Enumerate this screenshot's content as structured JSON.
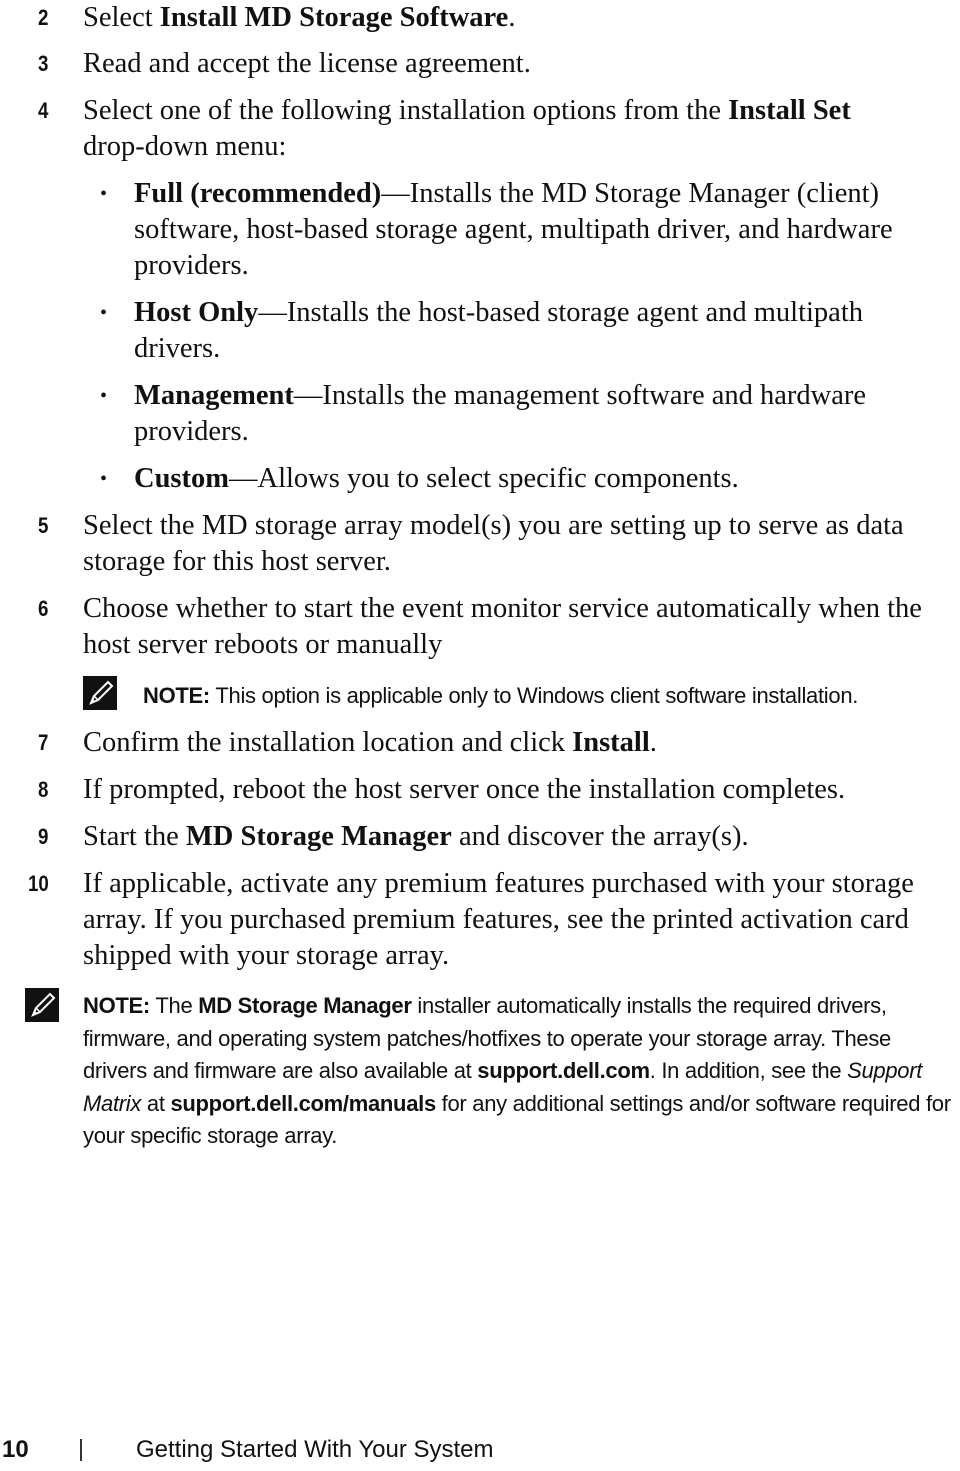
{
  "steps": [
    {
      "num": "2",
      "pre": "Select ",
      "bold": "Install MD Storage Software",
      "post": "."
    },
    {
      "num": "3",
      "text": "Read and accept the license agreement."
    },
    {
      "num": "4",
      "pre": "Select one of the following installation options from the ",
      "bold": "Install Set",
      "post": " drop-down menu:"
    },
    {
      "num": "5",
      "text": "Select the MD storage array model(s) you are setting up to serve as data storage for this host server."
    },
    {
      "num": "6",
      "text": "Choose whether to start the event monitor service automatically when the host server reboots or manually"
    },
    {
      "num": "7",
      "pre": "Confirm the installation location and click ",
      "bold": "Install",
      "post": "."
    },
    {
      "num": "8",
      "text": "If prompted, reboot the host server once the installation completes."
    },
    {
      "num": "9",
      "pre": "Start the ",
      "bold": "MD Storage Manager",
      "post": " and discover the array(s)."
    },
    {
      "num": "10",
      "text": "If applicable, activate any premium features purchased with your storage array. If you purchased premium features, see the printed activation card shipped with your storage array."
    }
  ],
  "options": [
    {
      "bold": "Full (recommended)",
      "text": "—Installs the MD Storage Manager (client) software, host-based storage agent, multipath driver, and hardware providers."
    },
    {
      "bold": "Host Only",
      "text": "—Installs the host-based storage agent and multipath drivers."
    },
    {
      "bold": "Management",
      "text": "—Installs the management software and hardware providers."
    },
    {
      "bold": "Custom",
      "text": "—Allows you to select specific components."
    }
  ],
  "note1": {
    "label": "NOTE:",
    "text": " This option is applicable only to Windows client software installation."
  },
  "note2": {
    "label": "NOTE:",
    "t1": " The ",
    "b1": "MD Storage Manager",
    "t2": " installer automatically installs the required drivers, firmware, and operating system patches/hotfixes to operate your storage array. These drivers and firmware are also available at ",
    "b2": "support.dell.com",
    "t3": ". In addition, see the ",
    "i1": "Support Matrix",
    "t4": " at ",
    "b3": "support.dell.com/manuals",
    "t5": " for any additional settings and/or software required for your specific storage array."
  },
  "footer": {
    "page_number": "10",
    "section_title": "Getting Started With Your System"
  }
}
